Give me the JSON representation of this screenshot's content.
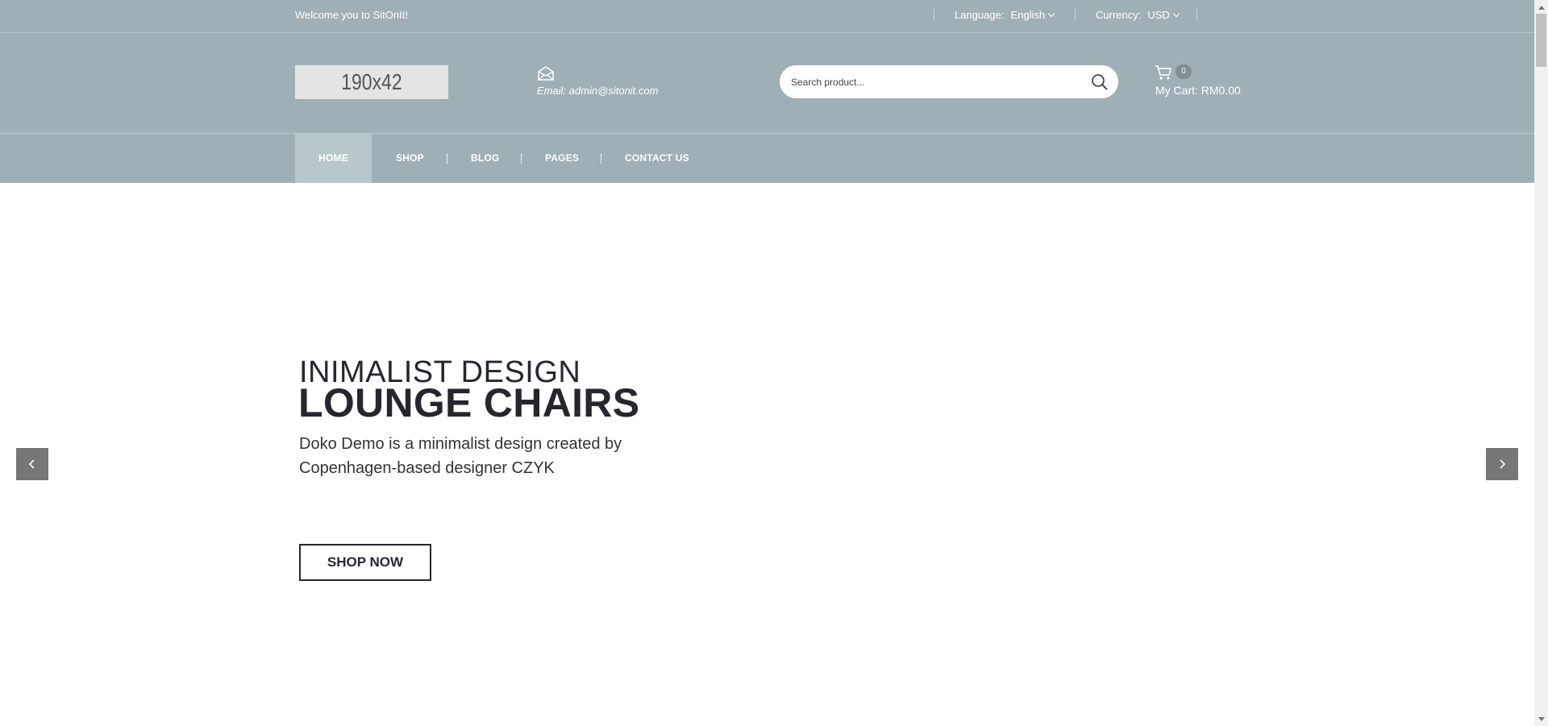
{
  "topbar": {
    "welcome": "Welcome you to SitOnIt!",
    "language_label": "Language:",
    "language_value": "English",
    "currency_label": "Currency:",
    "currency_value": "USD"
  },
  "header": {
    "logo_text": "190x42",
    "email": "Email: admin@sitonit.com",
    "search_placeholder": "Search product...",
    "cart_count": "0",
    "cart_label": "My Cart: RM0.00"
  },
  "nav": {
    "items": [
      {
        "label": "HOME",
        "active": true
      },
      {
        "label": "SHOP"
      },
      {
        "label": "BLOG"
      },
      {
        "label": "PAGES"
      },
      {
        "label": "CONTACT US"
      }
    ]
  },
  "hero": {
    "subtitle": "INIMALIST DESIGN",
    "title": "LOUNGE CHAIRS",
    "description": "Doko Demo is a minimalist design created by Copenhagen-based designer CZYK",
    "button": "SHOP NOW"
  },
  "colors": {
    "header_bg": "#9eb0b6",
    "nav_active_bg": "#b8c7cc",
    "text_dark": "#26262e"
  }
}
